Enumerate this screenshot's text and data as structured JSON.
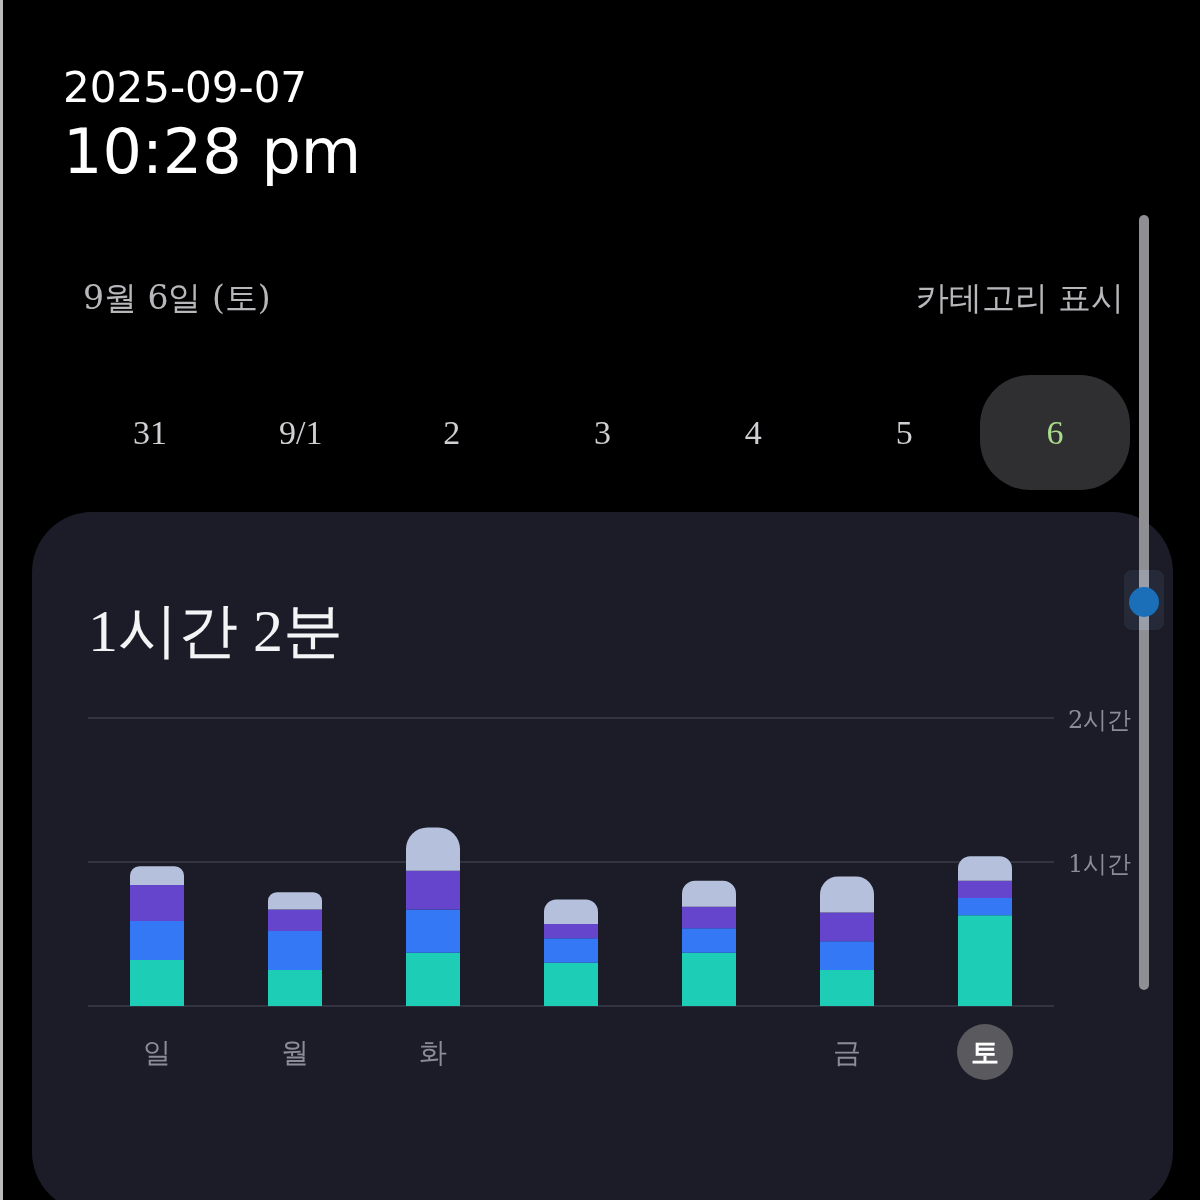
{
  "clock": {
    "date": "2025-09-07",
    "time": "10:28 pm"
  },
  "header": {
    "selected_date": "9월 6일 (토)",
    "category_toggle": "카테고리 표시"
  },
  "date_chips": [
    {
      "label": "31",
      "selected": false
    },
    {
      "label": "9/1",
      "selected": false
    },
    {
      "label": "2",
      "selected": false
    },
    {
      "label": "3",
      "selected": false
    },
    {
      "label": "4",
      "selected": false
    },
    {
      "label": "5",
      "selected": false
    },
    {
      "label": "6",
      "selected": true
    }
  ],
  "summary_card": {
    "total": "1시간 2분",
    "chart_data": {
      "type": "bar",
      "stacked": true,
      "ylim": [
        0,
        2
      ],
      "yticks": [
        {
          "value": 1,
          "label": "1시간"
        },
        {
          "value": 2,
          "label": "2시간"
        }
      ],
      "series": [
        {
          "color": "#1ecdb5",
          "values": [
            0.32,
            0.25,
            0.37,
            0.3,
            0.37,
            0.25,
            0.63
          ]
        },
        {
          "color": "#3478f6",
          "values": [
            0.27,
            0.27,
            0.3,
            0.17,
            0.17,
            0.2,
            0.12
          ]
        },
        {
          "color": "#6445cc",
          "values": [
            0.25,
            0.15,
            0.27,
            0.1,
            0.15,
            0.2,
            0.12
          ]
        },
        {
          "color": "#b4c0dc",
          "values": [
            0.13,
            0.12,
            0.3,
            0.17,
            0.18,
            0.25,
            0.17
          ]
        }
      ]
    },
    "day_labels": [
      {
        "label": "일",
        "selected": false
      },
      {
        "label": "월",
        "selected": false
      },
      {
        "label": "화",
        "selected": false
      },
      {
        "selected": false
      },
      {
        "selected": false
      },
      {
        "label": "금",
        "selected": false
      },
      {
        "label": "토",
        "selected": true
      }
    ]
  }
}
